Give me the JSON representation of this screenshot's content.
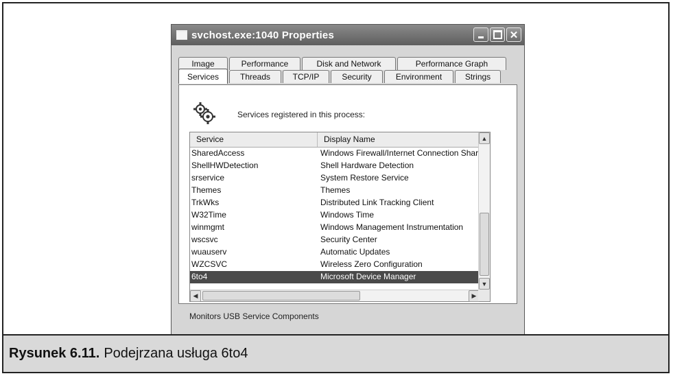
{
  "window": {
    "title": "svchost.exe:1040 Properties",
    "min_glyph": "",
    "max_glyph": "",
    "close_glyph": "✕"
  },
  "tabs_back": [
    "Image",
    "Performance",
    "Disk and Network",
    "Performance Graph"
  ],
  "tabs_front": [
    "Services",
    "Threads",
    "TCP/IP",
    "Security",
    "Environment",
    "Strings"
  ],
  "active_tab": "Services",
  "panel": {
    "icon": "gears-icon",
    "label": "Services registered in this process:"
  },
  "list": {
    "columns": [
      "Service",
      "Display Name"
    ],
    "rows": [
      [
        "SharedAccess",
        "Windows Firewall/Internet Connection Shar"
      ],
      [
        "ShellHWDetection",
        "Shell Hardware Detection"
      ],
      [
        "srservice",
        "System Restore Service"
      ],
      [
        "Themes",
        "Themes"
      ],
      [
        "TrkWks",
        "Distributed Link Tracking Client"
      ],
      [
        "W32Time",
        "Windows Time"
      ],
      [
        "winmgmt",
        "Windows Management Instrumentation"
      ],
      [
        "wscsvc",
        "Security Center"
      ],
      [
        "wuauserv",
        "Automatic Updates"
      ],
      [
        "WZCSVC",
        "Wireless Zero Configuration"
      ],
      [
        "6to4",
        "Microsoft Device Manager"
      ]
    ],
    "selected_index": 10
  },
  "description": "Monitors USB Service Components",
  "caption": {
    "prefix": "Rysunek 6.11.",
    "text": "Podejrzana usługa 6to4"
  }
}
